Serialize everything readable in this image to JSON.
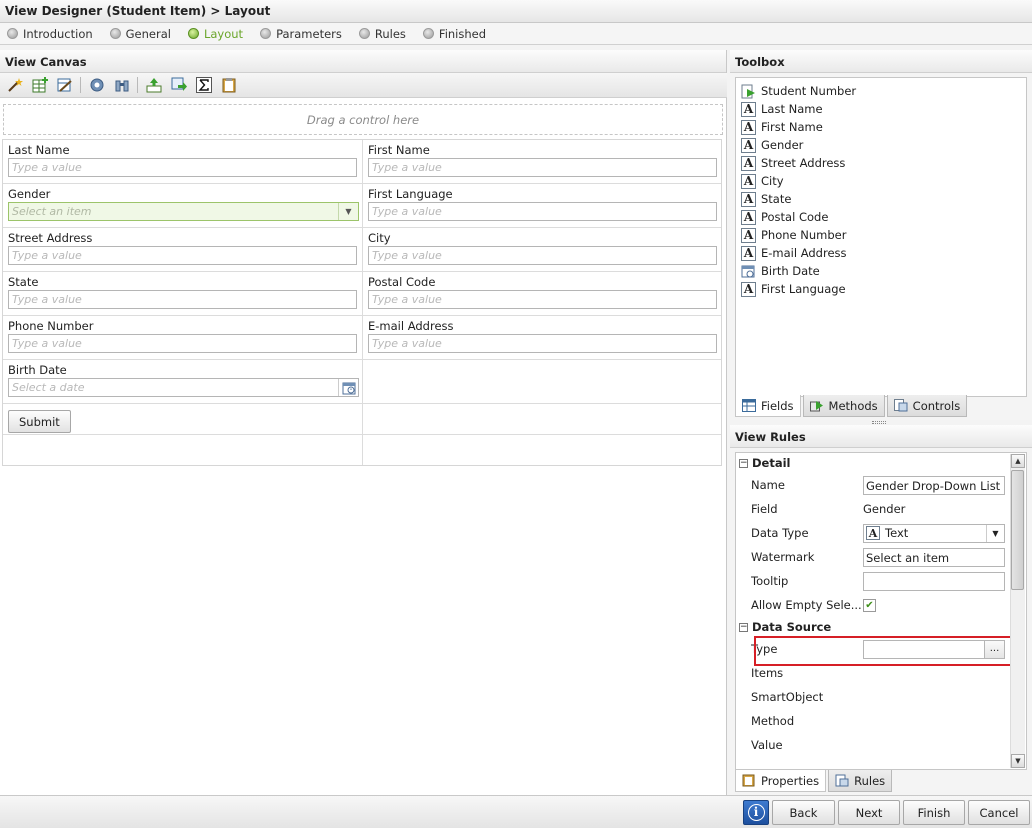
{
  "window": {
    "title": "View Designer (Student Item) > Layout"
  },
  "wizard": {
    "steps": [
      {
        "label": "Introduction",
        "state": "done"
      },
      {
        "label": "General",
        "state": "done"
      },
      {
        "label": "Layout",
        "state": "active"
      },
      {
        "label": "Parameters",
        "state": "pending"
      },
      {
        "label": "Rules",
        "state": "pending"
      },
      {
        "label": "Finished",
        "state": "pending"
      }
    ]
  },
  "canvas": {
    "header": "View Canvas",
    "toolbar_icons": [
      "wand-icon",
      "add-table-icon",
      "edit-table-icon",
      "settings-gear-icon",
      "binoculars-icon",
      "move-up-icon",
      "export-icon",
      "sigma-icon",
      "clipboard-icon"
    ],
    "drop_zone_text": "Drag a control here",
    "rows": [
      [
        {
          "label": "Last Name",
          "placeholder": "Type a value",
          "kind": "text"
        },
        {
          "label": "First Name",
          "placeholder": "Type a value",
          "kind": "text"
        }
      ],
      [
        {
          "label": "Gender",
          "placeholder": "Select an item",
          "kind": "select"
        },
        {
          "label": "First Language",
          "placeholder": "Type a value",
          "kind": "text"
        }
      ],
      [
        {
          "label": "Street Address",
          "placeholder": "Type a value",
          "kind": "text"
        },
        {
          "label": "City",
          "placeholder": "Type a value",
          "kind": "text"
        }
      ],
      [
        {
          "label": "State",
          "placeholder": "Type a value",
          "kind": "text"
        },
        {
          "label": "Postal Code",
          "placeholder": "Type a value",
          "kind": "text"
        }
      ],
      [
        {
          "label": "Phone Number",
          "placeholder": "Type a value",
          "kind": "text"
        },
        {
          "label": "E-mail Address",
          "placeholder": "Type a value",
          "kind": "text"
        }
      ],
      [
        {
          "label": "Birth Date",
          "placeholder": "Select a date",
          "kind": "date"
        },
        {
          "label": "",
          "kind": "empty"
        }
      ]
    ],
    "submit_label": "Submit"
  },
  "toolbox": {
    "header": "Toolbox",
    "items": [
      {
        "label": "Student Number",
        "icon": "autonumber-icon"
      },
      {
        "label": "Last Name",
        "icon": "text-field-icon"
      },
      {
        "label": "First Name",
        "icon": "text-field-icon"
      },
      {
        "label": "Gender",
        "icon": "text-field-icon"
      },
      {
        "label": "Street Address",
        "icon": "text-field-icon"
      },
      {
        "label": "City",
        "icon": "text-field-icon"
      },
      {
        "label": "State",
        "icon": "text-field-icon"
      },
      {
        "label": "Postal Code",
        "icon": "text-field-icon"
      },
      {
        "label": "Phone Number",
        "icon": "text-field-icon"
      },
      {
        "label": "E-mail Address",
        "icon": "text-field-icon"
      },
      {
        "label": "Birth Date",
        "icon": "date-field-icon"
      },
      {
        "label": "First Language",
        "icon": "text-field-icon"
      }
    ],
    "tabs": [
      {
        "label": "Fields",
        "active": true
      },
      {
        "label": "Methods",
        "active": false
      },
      {
        "label": "Controls",
        "active": false
      }
    ]
  },
  "rules": {
    "header": "View Rules",
    "detail_section": "Detail",
    "props": {
      "name_label": "Name",
      "name_value": "Gender Drop-Down List",
      "field_label": "Field",
      "field_value": "Gender",
      "datatype_label": "Data Type",
      "datatype_value": "Text",
      "watermark_label": "Watermark",
      "watermark_value": "Select an item",
      "tooltip_label": "Tooltip",
      "tooltip_value": "",
      "allow_empty_label": "Allow Empty Sele...",
      "allow_empty_checked": true
    },
    "datasource_section": "Data Source",
    "ds": {
      "type_label": "Type",
      "type_value": "",
      "type_button": "...",
      "items_label": "Items",
      "smartobject_label": "SmartObject",
      "method_label": "Method",
      "value_label": "Value"
    },
    "tabs": [
      {
        "label": "Properties",
        "active": true
      },
      {
        "label": "Rules",
        "active": false
      }
    ]
  },
  "footer": {
    "info": "i",
    "back": "Back",
    "next": "Next",
    "finish": "Finish",
    "cancel": "Cancel"
  }
}
